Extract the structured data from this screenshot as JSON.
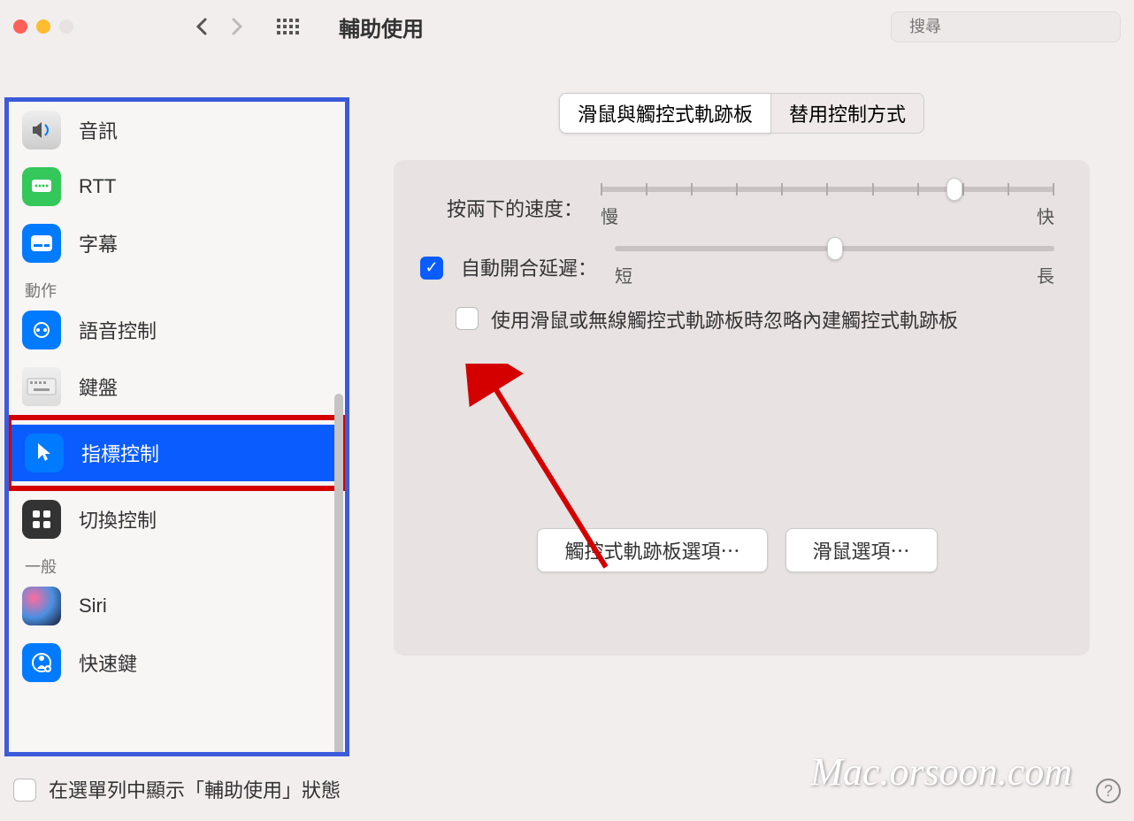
{
  "toolbar": {
    "title": "輔助使用",
    "search_placeholder": "搜尋"
  },
  "sidebar": {
    "items": [
      {
        "label": "音訊"
      },
      {
        "label": "RTT"
      },
      {
        "label": "字幕"
      }
    ],
    "section_actions": "動作",
    "action_items": [
      {
        "label": "語音控制"
      },
      {
        "label": "鍵盤"
      },
      {
        "label": "指標控制"
      },
      {
        "label": "切換控制"
      }
    ],
    "section_general": "一般",
    "general_items": [
      {
        "label": "Siri"
      },
      {
        "label": "快速鍵"
      }
    ]
  },
  "tabs": {
    "mouse_trackpad": "滑鼠與觸控式軌跡板",
    "alt_control": "替用控制方式"
  },
  "settings": {
    "double_click_label": "按兩下的速度：",
    "slow": "慢",
    "fast": "快",
    "spring_delay_label": "自動開合延遲：",
    "short": "短",
    "long": "長",
    "ignore_trackpad": "使用滑鼠或無線觸控式軌跡板時忽略內建觸控式軌跡板",
    "trackpad_options": "觸控式軌跡板選項⋯",
    "mouse_options": "滑鼠選項⋯"
  },
  "footer": {
    "show_in_menubar": "在選單列中顯示「輔助使用」狀態"
  },
  "watermark": "Mac.orsoon.com"
}
